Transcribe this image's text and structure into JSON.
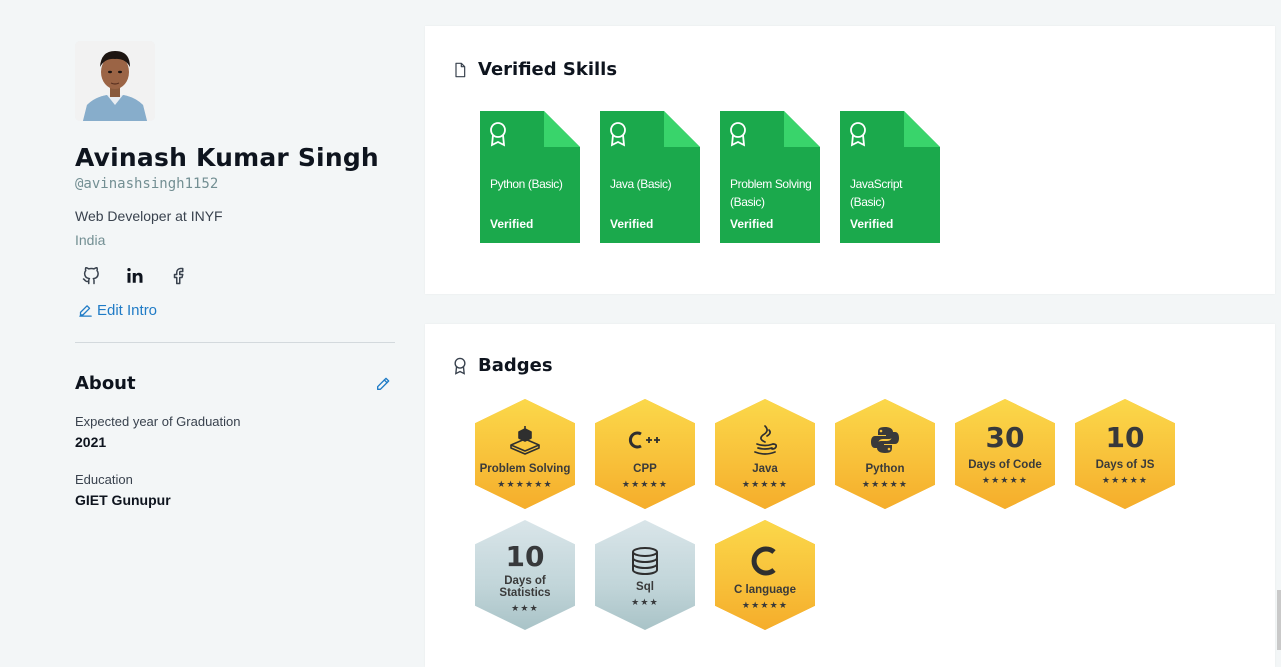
{
  "profile": {
    "name": "Avinash Kumar Singh",
    "handle": "@avinashsingh1152",
    "role": "Web Developer at INYF",
    "country": "India",
    "edit_intro": "Edit Intro",
    "socials": [
      "github-icon",
      "linkedin-icon",
      "facebook-icon"
    ]
  },
  "about": {
    "title": "About",
    "fields": [
      {
        "label": "Expected year of Graduation",
        "value": "2021"
      },
      {
        "label": "Education",
        "value": "GIET Gunupur"
      }
    ]
  },
  "skills": {
    "title": "Verified Skills",
    "items": [
      {
        "name": "Python (Basic)",
        "status": "Verified"
      },
      {
        "name": "Java (Basic)",
        "status": "Verified"
      },
      {
        "name": "Problem Solving (Basic)",
        "status": "Verified"
      },
      {
        "name": "JavaScript (Basic)",
        "status": "Verified"
      }
    ]
  },
  "badges": {
    "title": "Badges",
    "items": [
      {
        "name": "Problem Solving",
        "icon": "puzzle-icon",
        "stars": "★★★★★★",
        "tier": "gold"
      },
      {
        "name": "CPP",
        "icon": "cpp-icon",
        "stars": "★★★★★",
        "tier": "gold"
      },
      {
        "name": "Java",
        "icon": "java-icon",
        "stars": "★★★★★",
        "tier": "gold"
      },
      {
        "name": "Python",
        "icon": "python-icon",
        "stars": "★★★★★",
        "tier": "gold"
      },
      {
        "name": "Days of Code",
        "number": "30",
        "stars": "★★★★★",
        "tier": "gold"
      },
      {
        "name": "Days of JS",
        "number": "10",
        "stars": "★★★★★",
        "tier": "gold"
      },
      {
        "name": "Days of Statistics",
        "number": "10",
        "stars": "★★★",
        "tier": "silver"
      },
      {
        "name": "Sql",
        "icon": "database-icon",
        "stars": "★★★",
        "tier": "silver"
      },
      {
        "name": "C language",
        "icon": "c-language-icon",
        "stars": "★★★★★",
        "tier": "gold"
      }
    ]
  },
  "colors": {
    "skill_green": "#1ba94c",
    "gold": "#f8c13a",
    "silver": "#c1d5d9",
    "link_blue": "#1f7bc6"
  }
}
